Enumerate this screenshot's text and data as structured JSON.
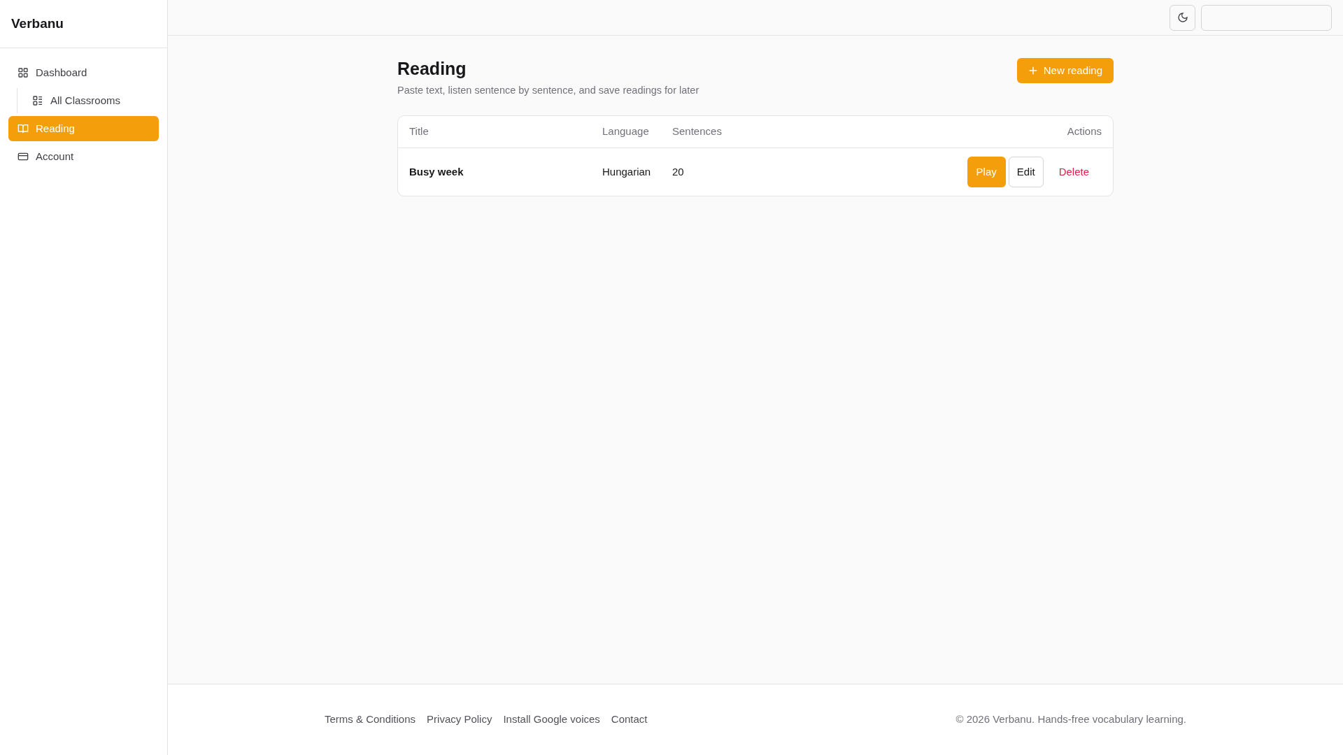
{
  "sidebar": {
    "brand": "Verbanu",
    "items": [
      {
        "label": "Dashboard",
        "selected": false,
        "children": [
          {
            "label": "All Classrooms",
            "selected": false
          }
        ]
      },
      {
        "label": "Reading",
        "selected": true
      },
      {
        "label": "Account",
        "selected": false
      }
    ]
  },
  "page": {
    "title": "Reading",
    "subtitle": "Paste text, listen sentence by sentence, and save readings for later",
    "new_button": "New reading"
  },
  "table": {
    "columns": [
      "Title",
      "Language",
      "Sentences",
      "Actions"
    ],
    "rows": [
      {
        "title": "Busy week",
        "language": "Hungarian",
        "sentences": "20",
        "actions": [
          "Play",
          "Edit",
          "Delete"
        ]
      }
    ]
  },
  "footer": {
    "links": [
      "Terms & Conditions",
      "Privacy Policy",
      "Install Google voices",
      "Contact"
    ],
    "copyright": "© 2026 Verbanu. Hands-free vocabulary learning."
  }
}
